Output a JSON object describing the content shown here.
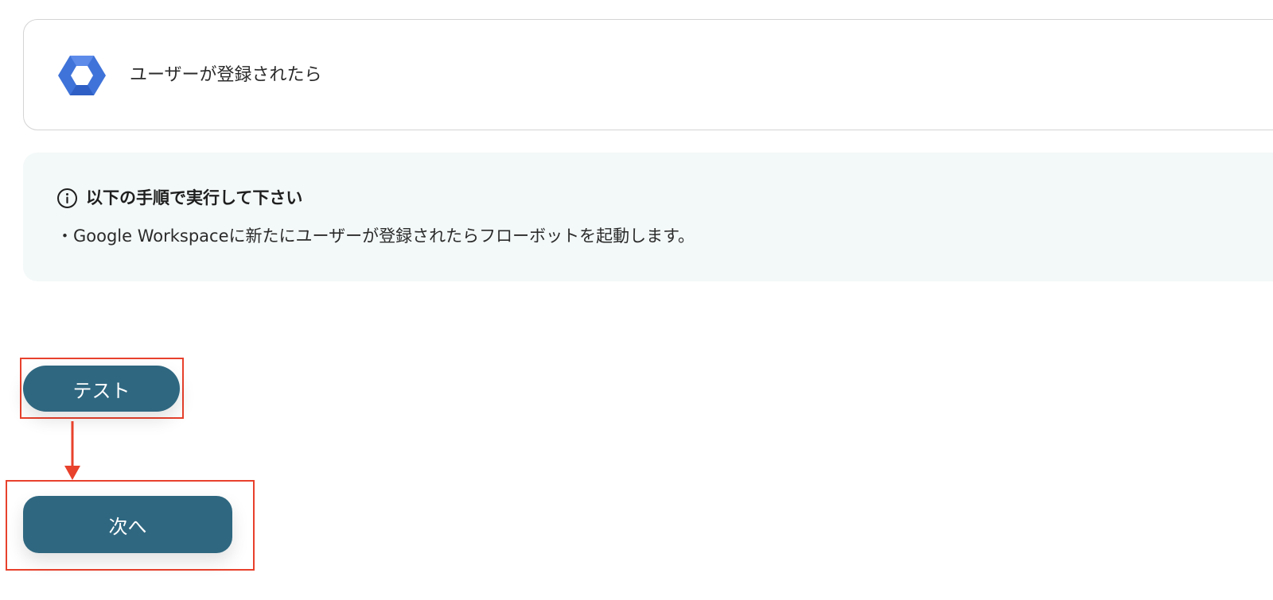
{
  "trigger": {
    "icon": "google-workspace-icon",
    "title": "ユーザーが登録されたら"
  },
  "info": {
    "icon": "info-icon",
    "heading": "以下の手順で実行して下さい",
    "body": "・Google Workspaceに新たにユーザーが登録されたらフローボットを起動します。"
  },
  "actions": {
    "test_label": "テスト",
    "next_label": "次へ"
  },
  "colors": {
    "primary_button": "#2f6780",
    "highlight": "#e8412c",
    "info_background": "#f3f8f8",
    "card_border": "#d4d4d4"
  }
}
